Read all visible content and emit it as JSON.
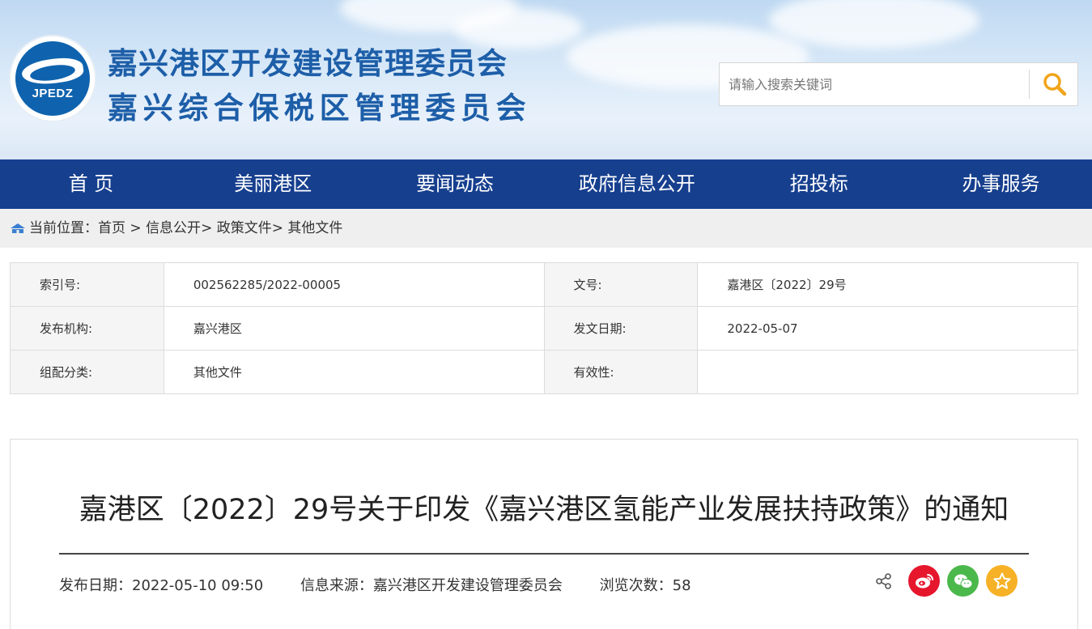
{
  "header": {
    "logo_text": "JPEDZ",
    "title_line1": "嘉兴港区开发建设管理委员会",
    "title_line2": "嘉兴综合保税区管理委员会"
  },
  "search": {
    "placeholder": "请输入搜索关键词",
    "icon": "search-icon"
  },
  "nav": {
    "items": [
      "首 页",
      "美丽港区",
      "要闻动态",
      "政府信息公开",
      "招投标",
      "办事服务"
    ]
  },
  "breadcrumb": {
    "prefix": "当前位置：",
    "home": "首页",
    "sep1": " > ",
    "level2": "信息公开",
    "sep2": "> ",
    "level3": "政策文件",
    "sep3": "> ",
    "level4": "其他文件"
  },
  "info": {
    "index_label": "索引号:",
    "index_value": "002562285/2022-00005",
    "docno_label": "文号:",
    "docno_value": "嘉港区〔2022〕29号",
    "org_label": "发布机构:",
    "org_value": "嘉兴港区",
    "date_label": "发文日期:",
    "date_value": "2022-05-07",
    "cat_label": "组配分类:",
    "cat_value": "其他文件",
    "valid_label": "有效性:",
    "valid_value": ""
  },
  "article": {
    "title": "嘉港区〔2022〕29号关于印发《嘉兴港区氢能产业发展扶持政策》的通知",
    "publish_date": "发布日期：2022-05-10 09:50",
    "source": "信息来源：嘉兴港区开发建设管理委员会",
    "views": "浏览次数：58"
  },
  "colors": {
    "nav_bg": "#163f8e",
    "title_blue": "#1d5ea8",
    "weibo": "#e6162d",
    "wechat": "#4bb84b",
    "favorite": "#f6b126"
  }
}
